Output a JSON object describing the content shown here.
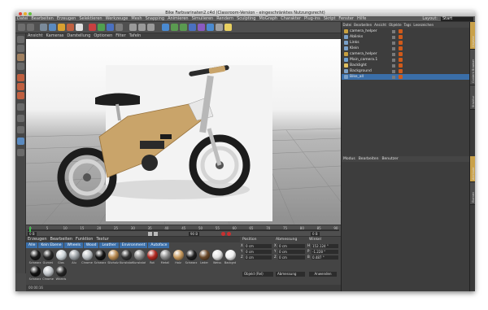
{
  "window": {
    "title": "Bike Farbvarinaten2.c4d (Classroom-Version - eingeschränktes Nutzungsrecht)"
  },
  "menubar": {
    "items": [
      "Datei",
      "Bearbeiten",
      "Erzeugen",
      "Selektieren",
      "Werkzeuge",
      "Mesh",
      "Snapping",
      "Animieren",
      "Simulieren",
      "Rendern",
      "Sculpting",
      "MoGraph",
      "Charakter",
      "Plug-ins",
      "Skript",
      "Fenster",
      "Hilfe"
    ],
    "layout_label": "Layout:",
    "layout_value": "Start"
  },
  "viewport": {
    "menu": [
      "Ansicht",
      "Kameras",
      "Darstellung",
      "Optionen",
      "Filter",
      "Tafeln"
    ]
  },
  "timeline": {
    "ticks": [
      "0",
      "5",
      "10",
      "15",
      "20",
      "25",
      "30",
      "35",
      "40",
      "45",
      "50",
      "55",
      "60",
      "65",
      "70",
      "75",
      "80",
      "85",
      "90"
    ],
    "current_frame": "0 B",
    "end_frame": "90 B",
    "frame_display": "0 B"
  },
  "material_manager": {
    "menu": [
      "Erzeugen",
      "Bearbeiten",
      "Funktion",
      "Textur"
    ],
    "tabs": [
      "Alle",
      "Kein Ebene",
      "Wheels",
      "Wood",
      "Leather",
      "Environment",
      "Autoface"
    ],
    "materials_row1": [
      {
        "name": "Schwarz",
        "color": "#1a1a1a"
      },
      {
        "name": "Gummi",
        "color": "#2a2a2a"
      },
      {
        "name": "Glas",
        "color": "#cfd6da"
      },
      {
        "name": "Alu",
        "color": "#9aa0a4"
      },
      {
        "name": "Chrome",
        "color": "#bfc4c8"
      },
      {
        "name": "Schwarz",
        "color": "#151515"
      },
      {
        "name": "Sitzholz",
        "color": "#b88b52"
      },
      {
        "name": "Kunststoff",
        "color": "#333333"
      },
      {
        "name": "Kunststoff",
        "color": "#8d8d8d"
      },
      {
        "name": "Rot",
        "color": "#b22a22"
      },
      {
        "name": "Metall",
        "color": "#8a8a8a"
      },
      {
        "name": "Holz",
        "color": "#c79a5e"
      },
      {
        "name": "Schwarz",
        "color": "#202020"
      },
      {
        "name": "Leder",
        "color": "#6b4a2b"
      },
      {
        "name": "Weiss",
        "color": "#e4e4e4"
      },
      {
        "name": "Backgrd",
        "color": "#f0f0f0"
      }
    ],
    "materials_row2": [
      {
        "name": "Schwarz",
        "color": "#111111"
      },
      {
        "name": "Chrome",
        "color": "#c4c8cc"
      },
      {
        "name": "Wheels",
        "color": "#262626"
      }
    ]
  },
  "coordinates": {
    "headers": [
      "Position",
      "Abmessung",
      "Winkel"
    ],
    "rows": [
      {
        "axis": "X",
        "pos": "0 cm",
        "size_axis": "X",
        "size": "0 cm",
        "rot_axis": "H",
        "rot": "152.124 °"
      },
      {
        "axis": "Y",
        "pos": "0 cm",
        "size_axis": "Y",
        "size": "0 cm",
        "rot_axis": "P",
        "rot": "-1.228 °"
      },
      {
        "axis": "Z",
        "pos": "0 cm",
        "size_axis": "Z",
        "size": "0 cm",
        "rot_axis": "B",
        "rot": "0.487 °"
      }
    ],
    "mode": "Objekt (Rel)",
    "size_mode": "Abmessung",
    "apply": "Anwenden"
  },
  "object_manager": {
    "menu": [
      "Datei",
      "Bearbeiten",
      "Ansicht",
      "Objekte",
      "Tags",
      "Lesezeichen"
    ],
    "objects": [
      {
        "name": "camera_helper",
        "icon": "#c8a040",
        "tag": "#d05a1a"
      },
      {
        "name": "Ablinks",
        "icon": "#7aa0c8",
        "tag": "#d05a1a"
      },
      {
        "name": "Links",
        "icon": "#7aa0c8",
        "tag": "#d05a1a"
      },
      {
        "name": "Klein",
        "icon": "#7aa0c8",
        "tag": "#d05a1a"
      },
      {
        "name": "camera_helper",
        "icon": "#c8a040",
        "tag": "#d05a1a"
      },
      {
        "name": "Main_camera.1",
        "icon": "#6fa0d0",
        "tag": "#d05a1a"
      },
      {
        "name": "Backlight",
        "icon": "#e0c060",
        "tag": "#d05a1a"
      },
      {
        "name": "Background",
        "icon": "#7aa0c8",
        "tag": "#d05a1a"
      },
      {
        "name": "Bike_all",
        "icon": "#7aa0c8",
        "tag": "#d05a1a"
      }
    ]
  },
  "attribute_manager": {
    "menu": [
      "Modus",
      "Bearbeiten",
      "Benutzer"
    ]
  },
  "side_tabs": [
    "Objekte",
    "Content Browser",
    "Struktur",
    "Attribute",
    "Ebenen"
  ],
  "status": {
    "text": "00:00:16"
  },
  "colors": {
    "timeline_accent": "#39c04a",
    "material_tab": "#3a6ea8",
    "selected_row": "#3a6ea8",
    "side_tab_active": "#c9a14a"
  }
}
